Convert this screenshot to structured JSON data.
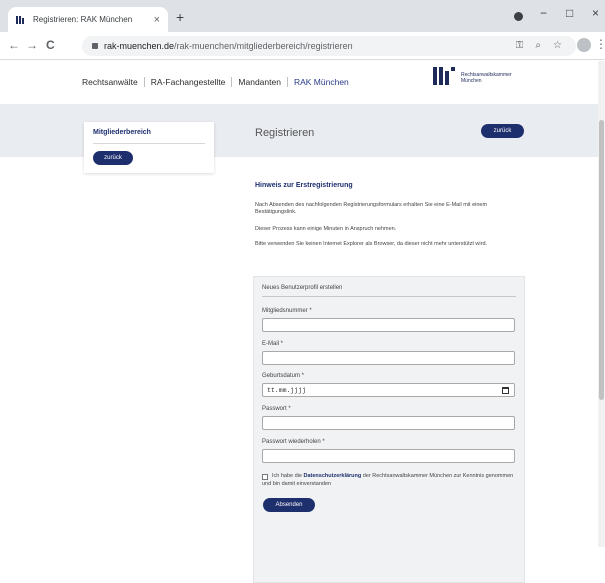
{
  "browser": {
    "tab_title": "Registrieren: RAK München",
    "tab_close": "×",
    "new_tab": "+",
    "url_host": "rak-muenchen.de",
    "url_path": "/rak-muenchen/mitgliederbereich/registrieren",
    "nav_back": "←",
    "nav_forward": "→",
    "nav_reload": "C",
    "win_min": "−",
    "win_max": "□",
    "win_close": "×",
    "icon_key": "⚿",
    "icon_zoom": "⌕",
    "icon_star": "☆",
    "menu": "⋮"
  },
  "topnav": {
    "items": [
      "Rechtsanwälte",
      "RA-Fachangestellte",
      "Mandanten",
      "RAK München"
    ]
  },
  "logo": {
    "line1": "Rechtsanwaltskammer",
    "line2": "München"
  },
  "sidebar": {
    "title": "Mitgliederbereich",
    "back_label": "zurück"
  },
  "header": {
    "title": "Registrieren",
    "back_label": "zurück"
  },
  "hint": {
    "title": "Hinweis zur Erstregistrierung",
    "p1": "Nach Absenden des nachfolgenden Registrierungsformulars erhalten Sie eine E-Mail mit einem Bestätigungslink.",
    "p2": "Dieser Prozess kann einige Minuten in Anspruch nehmen.",
    "p3": "Bitte verwenden Sie keinen Internet Explorer als Browser, da dieser nicht mehr unterstützt wird."
  },
  "form": {
    "heading": "Neues Benutzerprofil erstellen",
    "fields": [
      {
        "label": "Mitgliedsnummer *",
        "value": ""
      },
      {
        "label": "E-Mail *",
        "value": ""
      },
      {
        "label": "Geburtsdatum *",
        "value": "tt.mm.jjjj"
      },
      {
        "label": "Passwort *",
        "value": ""
      },
      {
        "label": "Passwort wiederholen *",
        "value": ""
      }
    ],
    "consent_pre": "Ich habe die",
    "consent_link": "Datenschutzerklärung",
    "consent_post": "der Rechtsanwaltskammer München zur Kenntnis genommen und bin damit einverstanden",
    "submit_label": "Absenden"
  }
}
